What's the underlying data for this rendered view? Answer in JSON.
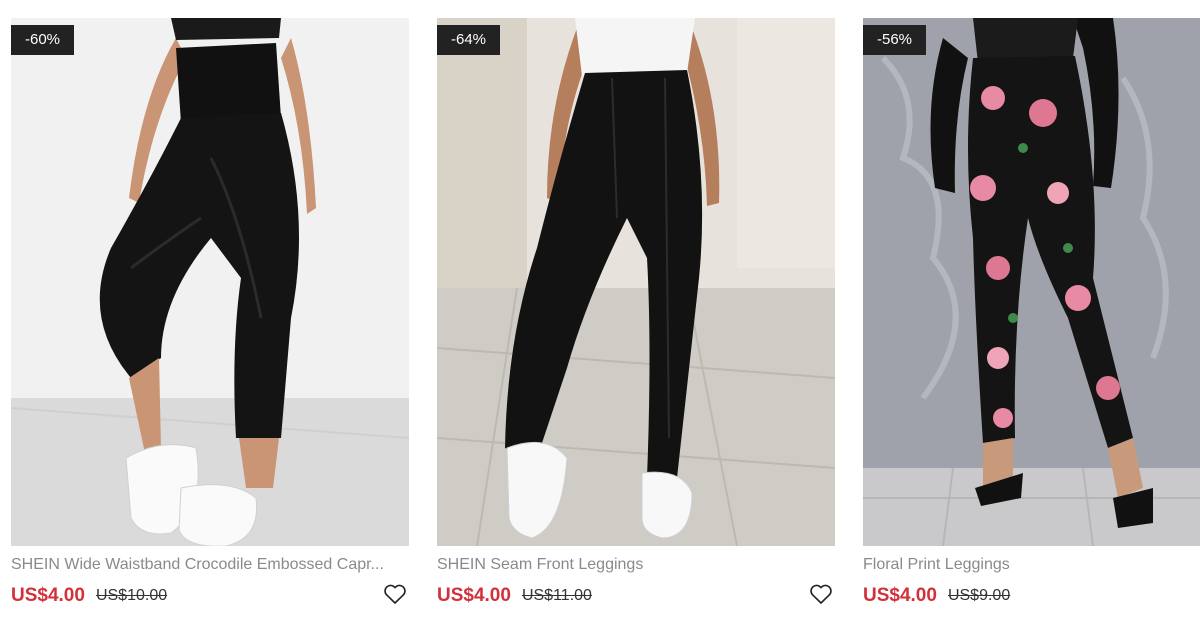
{
  "products": [
    {
      "discount": "-60%",
      "title": "SHEIN Wide Waistband Crocodile Embossed Capr...",
      "price": "US$4.00",
      "original_price": "US$10.00",
      "image_alt": "black crocodile embossed capri leggings with white sneakers"
    },
    {
      "discount": "-64%",
      "title": "SHEIN Seam Front Leggings",
      "price": "US$4.00",
      "original_price": "US$11.00",
      "image_alt": "black seam front leggings with white sneakers"
    },
    {
      "discount": "-56%",
      "title": "Floral Print Leggings",
      "price": "US$4.00",
      "original_price": "US$9.00",
      "image_alt": "black floral print leggings with heeled sandals"
    }
  ],
  "icons": {
    "wishlist": "heart-outline-icon"
  },
  "colors": {
    "sale_price": "#d3303a",
    "badge_bg": "#222222",
    "title_text": "#8a8a8a"
  }
}
